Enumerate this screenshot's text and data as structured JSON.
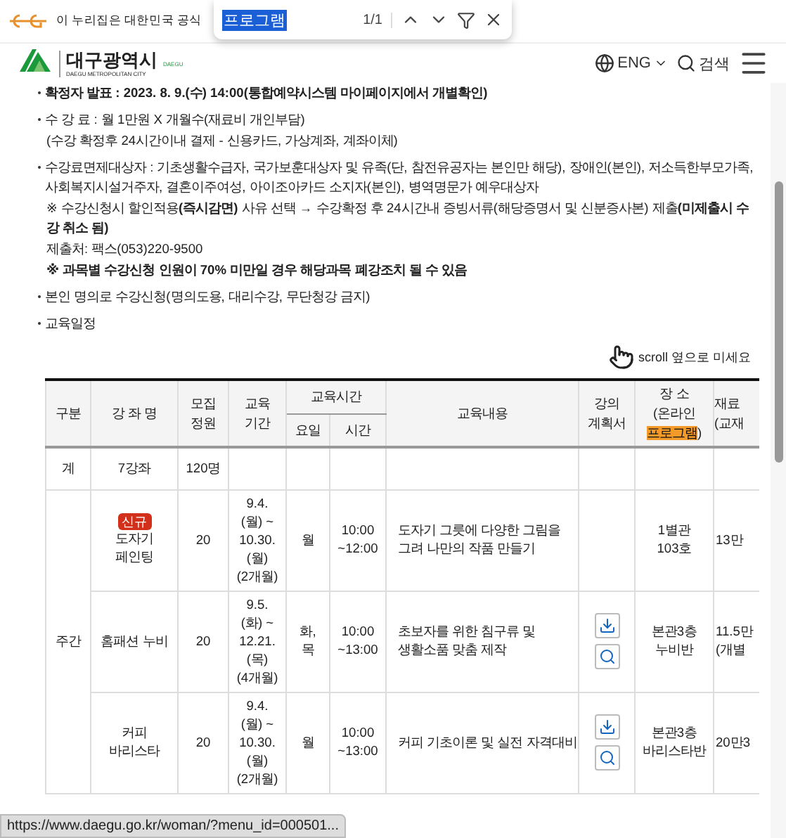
{
  "banner": {
    "text": "이 누리집은 대한민국 공식"
  },
  "find_bar": {
    "query": "프로그램",
    "count": "1/1"
  },
  "header": {
    "logo_mark": "DAEGU",
    "title": "대구광역시",
    "subtitle": "DAEGU METROPOLITAN CITY",
    "language": "ENG",
    "search": "검색"
  },
  "notices": [
    {
      "kind": "bullet",
      "text": "확정자 발표 : 2023. 8. 9.(수) 14:00(통합예약시스템 마이페이지에서 개별확인)",
      "bold": true
    },
    {
      "kind": "bullet",
      "text": "수 강 료 : 월 1만원 X 개월수(재료비 개인부담)",
      "bold": false
    },
    {
      "kind": "sub",
      "text": "(수강 확정후 24시간이내 결제 - 신용카드, 가상계좌, 계좌이체)",
      "bold": false
    },
    {
      "kind": "bullet",
      "text": "수강료면제대상자 : 기초생활수급자, 국가보훈대상자 및 유족(단, 참전유공자는 본인만 해당), 장애인(본인), 저소득한부모가족, 사회복지시설거주자, 결혼이주여성, 아이조아카드 소지자(본인), 병역명문가 예우대상자",
      "bold": false
    },
    {
      "kind": "sub",
      "text": "※ 수강신청시 할인적용**(즉시감면)** 사유 선택 → 수강확정 후 24시간내 증빙서류(해당증명서 및 신분증사본) 제출**(미제출시 수강 취소 됨)**",
      "bold": false
    },
    {
      "kind": "sub",
      "text": "제출처: 팩스(053)220-9500",
      "bold": false
    },
    {
      "kind": "sub",
      "text": "※ 과목별 수강신청 인원이 70% 미만일 경우 해당과목 폐강조치 될 수 있음",
      "bold": true
    },
    {
      "kind": "bullet",
      "text": "본인 명의로 수강신청(명의도용, 대리수강, 무단청강 금지)",
      "bold": false
    },
    {
      "kind": "bullet",
      "text": "교육일정",
      "bold": false
    }
  ],
  "scroll_hint": "scroll 옆으로 미세요",
  "table": {
    "header": {
      "division": "구분",
      "course": "강 좌 명",
      "capacity": "모집\n정원",
      "period": "교육\n기간",
      "time_group": "교육시간",
      "day": "요일",
      "time": "시간",
      "content": "교육내용",
      "plan": "강의\n계획서",
      "place": "장 소\n(온라인\n",
      "place_match": "프로그램",
      "place_end": ")",
      "fee": "재료\n(교재"
    },
    "total": {
      "label": "계",
      "course": "7강좌",
      "capacity": "120명"
    },
    "group": {
      "label": "주간",
      "rows": [
        {
          "badge": "신규",
          "name": "도자기\n페인팅",
          "capacity": "20",
          "period": "9.4.\n(월) ~\n10.30.\n(월)\n(2개월)",
          "day": "월",
          "time": "10:00\n~12:00",
          "content": "도자기 그릇에 다양한 그림을\n그려 나만의 작품 만들기",
          "plan": false,
          "place": "1별관\n103호",
          "fee": "13만"
        },
        {
          "name": "홈패션 누비",
          "capacity": "20",
          "period": "9.5.\n(화) ~\n12.21.\n(목)\n(4개월)",
          "day": "화,\n목",
          "time": "10:00\n~13:00",
          "content": "초보자를 위한 침구류 및\n생활소품 맞춤 제작",
          "plan": true,
          "place": "본관3층\n누비반",
          "fee": "11.5만\n(개별"
        },
        {
          "name": "커피\n바리스타",
          "capacity": "20",
          "period": "9.4.\n(월) ~\n10.30.\n(월)\n(2개월)",
          "day": "월",
          "time": "10:00\n~13:00",
          "content": "커피 기초이론 및 실전 자격대비",
          "plan": true,
          "place": "본관3층\n바리스타반",
          "fee": "20만3"
        }
      ]
    }
  },
  "status_url": "https://www.daegu.go.kr/woman/?menu_id=000501..."
}
